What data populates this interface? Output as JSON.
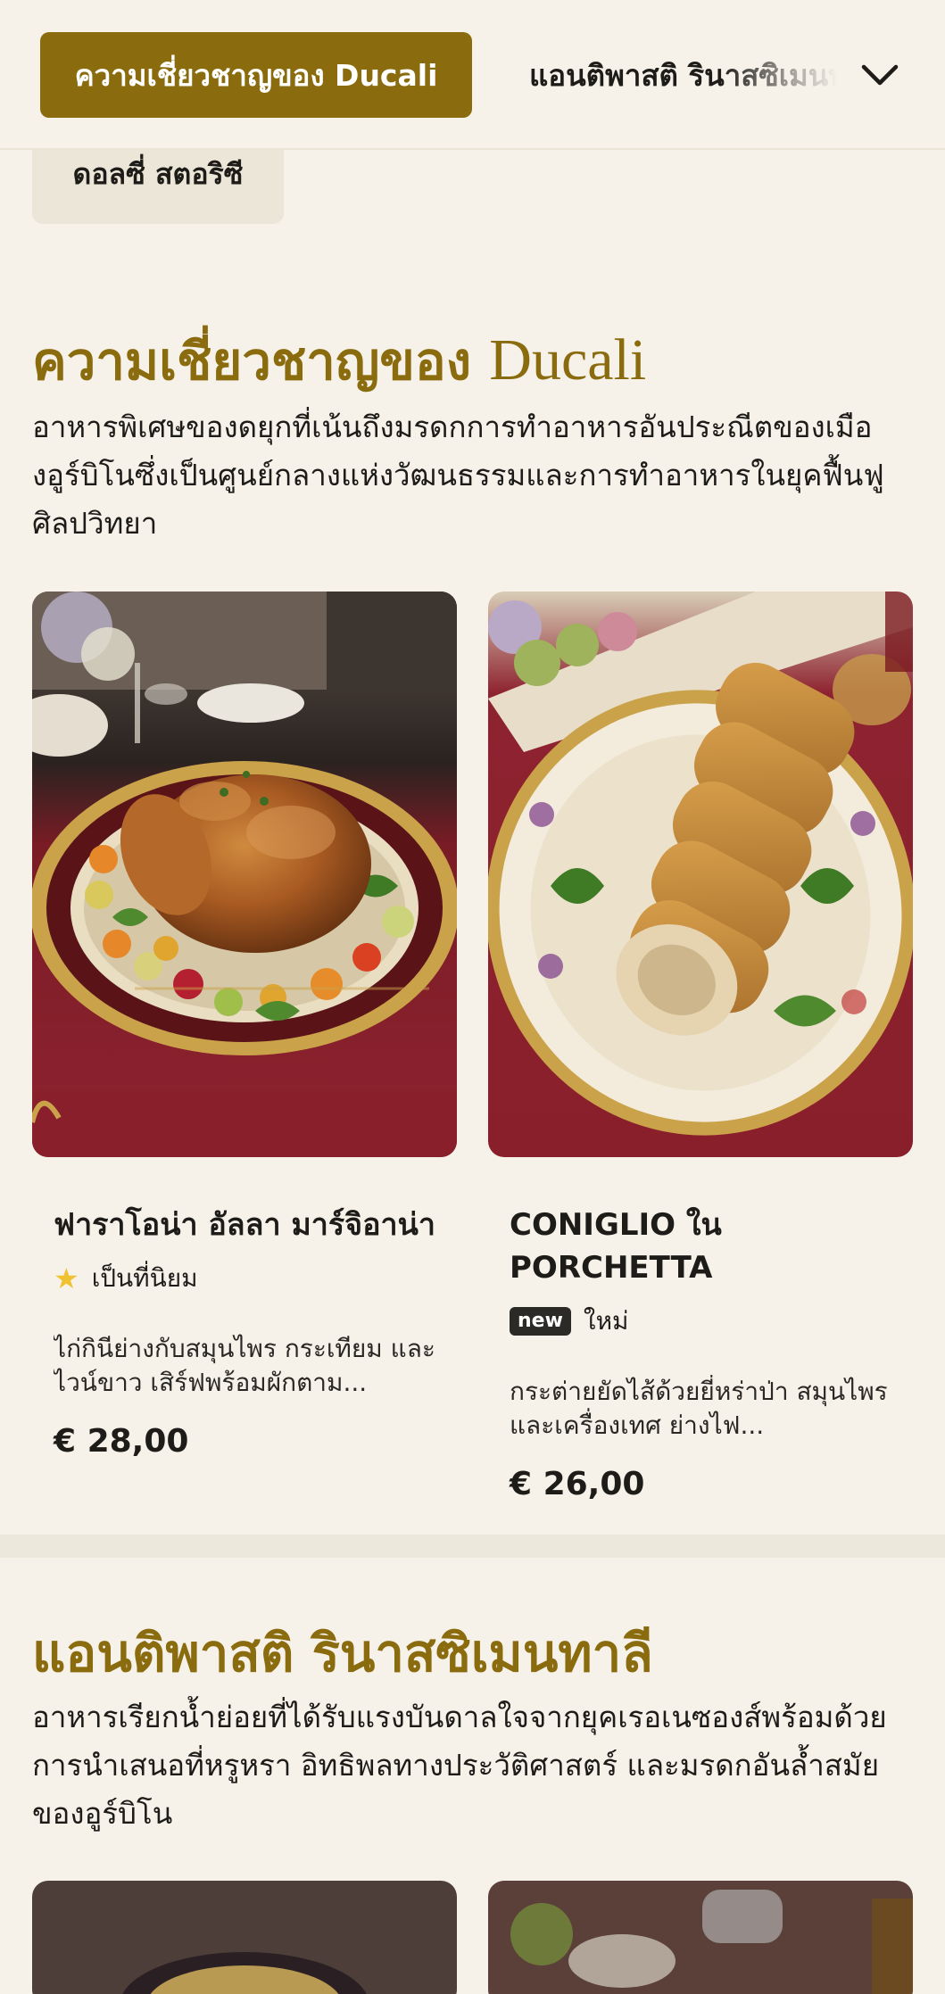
{
  "categories": {
    "active": "ความเชี่ยวชาญของ Ducali",
    "next": "แอนติพาสติ รินาสซิเมนทาลี",
    "previous": "ดอลซี่ สตอริซี",
    "expand_icon": "chevron-down-icon"
  },
  "sections": [
    {
      "title_thai": "ความเชี่ยวชาญของ",
      "title_latin": "Ducali",
      "description": "อาหารพิเศษของดยุกที่เน้นถึงมรดกการทำอาหารอันประณีตของเมืองอูร์บิโนซึ่งเป็นศูนย์กลางแห่งวัฒนธรรมและการทำอาหารในยุคฟื้นฟูศิลปวิทยา",
      "items": [
        {
          "name": "ฟาราโอน่า อัลลา มาร์จิอาน่า",
          "tag": "เป็นที่นิยม",
          "tag_icon": "star-icon",
          "description": "ไก่กินีย่างกับสมุนไพร กระเทียม และไวน์ขาว เสิร์ฟพร้อมผักตาม...",
          "price": "€ 28,00"
        },
        {
          "name": "CONIGLIO ใน PORCHETTA",
          "badge": "new",
          "tag": "ใหม่",
          "description": "กระต่ายยัดไส้ด้วยยี่หร่าป่า สมุนไพร และเครื่องเทศ ย่างไฟ...",
          "price": "€ 26,00"
        }
      ]
    },
    {
      "title_thai": "แอนติพาสติ รินาสซิเมนทาลี",
      "description": "อาหารเรียกน้ำย่อยที่ได้รับแรงบันดาลใจจากยุคเรอเนซองส์พร้อมด้วยการนำเสนอที่หรูหรา อิทธิพลทางประวัติศาสตร์ และมรดกอันล้ำสมัยของอูร์บิโน"
    }
  ],
  "colors": {
    "accent": "#8a6c0f",
    "background": "#f6f2ea",
    "chip_bg": "#ece6d8",
    "star": "#f0c232"
  }
}
